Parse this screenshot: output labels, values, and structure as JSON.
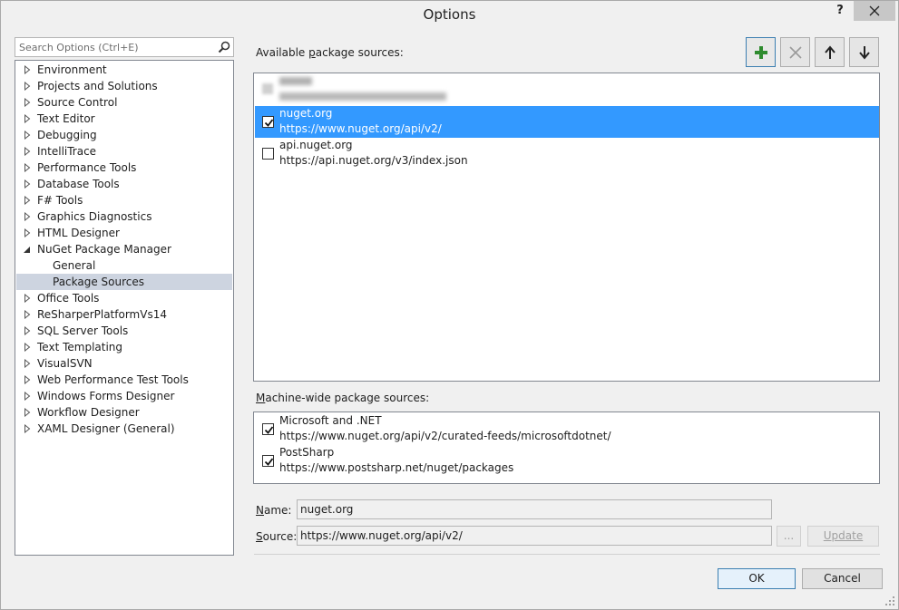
{
  "window": {
    "title": "Options",
    "help_label": "?"
  },
  "search": {
    "placeholder": "Search Options (Ctrl+E)"
  },
  "tree": {
    "items": [
      {
        "label": "Environment",
        "expanded": false
      },
      {
        "label": "Projects and Solutions",
        "expanded": false
      },
      {
        "label": "Source Control",
        "expanded": false
      },
      {
        "label": "Text Editor",
        "expanded": false
      },
      {
        "label": "Debugging",
        "expanded": false
      },
      {
        "label": "IntelliTrace",
        "expanded": false
      },
      {
        "label": "Performance Tools",
        "expanded": false
      },
      {
        "label": "Database Tools",
        "expanded": false
      },
      {
        "label": "F# Tools",
        "expanded": false
      },
      {
        "label": "Graphics Diagnostics",
        "expanded": false
      },
      {
        "label": "HTML Designer",
        "expanded": false
      },
      {
        "label": "NuGet Package Manager",
        "expanded": true
      },
      {
        "label": "General",
        "child": true
      },
      {
        "label": "Package Sources",
        "child": true,
        "selected": true
      },
      {
        "label": "Office Tools",
        "expanded": false
      },
      {
        "label": "ReSharperPlatformVs14",
        "expanded": false
      },
      {
        "label": "SQL Server Tools",
        "expanded": false
      },
      {
        "label": "Text Templating",
        "expanded": false
      },
      {
        "label": "VisualSVN",
        "expanded": false
      },
      {
        "label": "Web Performance Test Tools",
        "expanded": false
      },
      {
        "label": "Windows Forms Designer",
        "expanded": false
      },
      {
        "label": "Workflow Designer",
        "expanded": false
      },
      {
        "label": "XAML Designer (General)",
        "expanded": false
      }
    ]
  },
  "available": {
    "label_pre": "Available ",
    "label_accel": "p",
    "label_post": "ackage sources:",
    "sources": [
      {
        "name": "nuget.org",
        "url": "https://www.nuget.org/api/v2/",
        "checked": true,
        "selected": true
      },
      {
        "name": "api.nuget.org",
        "url": "https://api.nuget.org/v3/index.json",
        "checked": false,
        "selected": false
      }
    ]
  },
  "machine_wide": {
    "label_accel": "M",
    "label_post": "achine-wide package sources:",
    "sources": [
      {
        "name": "Microsoft and .NET",
        "url": "https://www.nuget.org/api/v2/curated-feeds/microsoftdotnet/",
        "checked": true
      },
      {
        "name": "PostSharp",
        "url": "https://www.postsharp.net/nuget/packages",
        "checked": true
      }
    ]
  },
  "details": {
    "name_accel": "N",
    "name_post": "ame:",
    "name_value": "nuget.org",
    "source_accel": "S",
    "source_post": "ource:",
    "source_value": "https://www.nuget.org/api/v2/",
    "browse_label": "...",
    "update_label": "Update"
  },
  "footer": {
    "ok_label": "OK",
    "cancel_label": "Cancel"
  },
  "colors": {
    "selection": "#3399ff",
    "add_icon": "#2e8b2e"
  }
}
